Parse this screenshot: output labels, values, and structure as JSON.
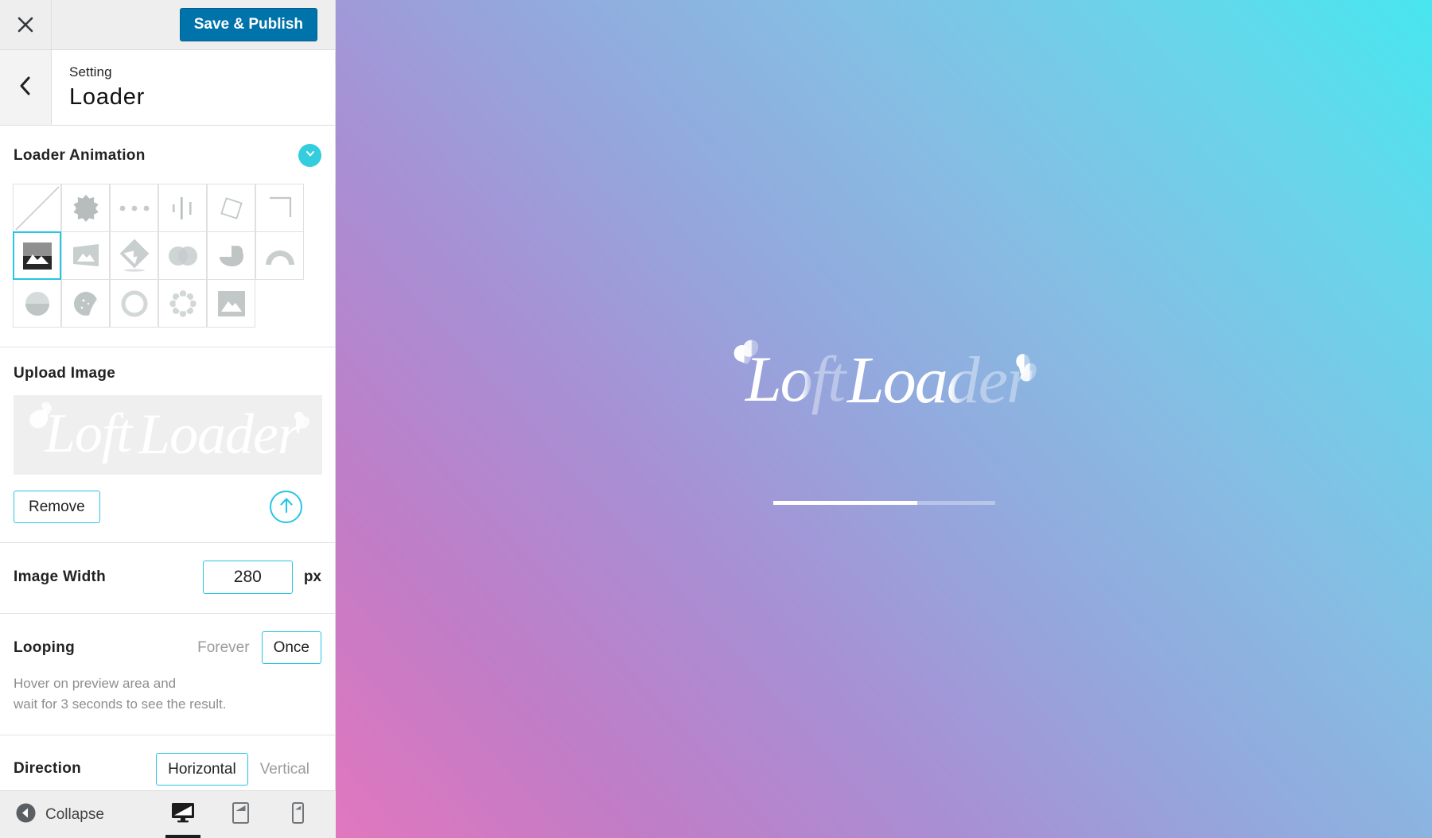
{
  "header": {
    "close_icon": "close-icon",
    "save_label": "Save & Publish",
    "save_color": "#0073aa"
  },
  "panel": {
    "back_icon": "chevron-left-icon",
    "breadcrumb": "Setting",
    "title": "Loader"
  },
  "accent_color": "#29c5e6",
  "toggle_color": "#33cddd",
  "sections": {
    "animation": {
      "label": "Loader Animation",
      "collapse_icon": "chevron-down-icon",
      "selected_index": 6,
      "items": [
        {
          "name": "none-diagonal-icon",
          "label": "None"
        },
        {
          "name": "starburst-icon",
          "label": "Starburst"
        },
        {
          "name": "three-dots-icon",
          "label": "Three Dots"
        },
        {
          "name": "equalizer-bars-icon",
          "label": "Bars"
        },
        {
          "name": "rotating-square-icon",
          "label": "Rotating Square"
        },
        {
          "name": "corner-bracket-icon",
          "label": "Corner Bracket"
        },
        {
          "name": "image-fill-icon",
          "label": "Image Fill"
        },
        {
          "name": "image-skew-icon",
          "label": "Image Skew"
        },
        {
          "name": "image-diamond-icon",
          "label": "Image Diamond"
        },
        {
          "name": "overlap-circles-icon",
          "label": "Overlapping Circles"
        },
        {
          "name": "blob-bird-icon",
          "label": "Blob"
        },
        {
          "name": "arch-icon",
          "label": "Arch"
        },
        {
          "name": "half-circle-icon",
          "label": "Half Circle"
        },
        {
          "name": "cookie-icon",
          "label": "Cookie"
        },
        {
          "name": "ring-icon",
          "label": "Ring"
        },
        {
          "name": "flower-ring-icon",
          "label": "Flower Ring"
        },
        {
          "name": "image-square-icon",
          "label": "Image Square"
        }
      ]
    },
    "upload": {
      "label": "Upload Image",
      "preview_alt": "LoftLoader",
      "remove_label": "Remove",
      "upload_icon": "upload-arrow-icon"
    },
    "image_width": {
      "label": "Image Width",
      "value": "280",
      "unit": "px"
    },
    "looping": {
      "label": "Looping",
      "options": [
        "Forever",
        "Once"
      ],
      "selected": "Once",
      "help_line_1": "Hover on preview area and",
      "help_line_2": "wait for 3 seconds to see the result."
    },
    "direction": {
      "label": "Direction",
      "options": [
        "Horizontal",
        "Vertical"
      ],
      "selected": "Horizontal"
    }
  },
  "bottom_bar": {
    "collapse_icon": "collapse-left-icon",
    "collapse_label": "Collapse",
    "devices": [
      {
        "name": "desktop-icon",
        "label": "Desktop",
        "active": true
      },
      {
        "name": "tablet-icon",
        "label": "Tablet",
        "active": false
      },
      {
        "name": "mobile-icon",
        "label": "Mobile",
        "active": false
      }
    ]
  },
  "preview": {
    "logo_text": "LoftLoader",
    "gradient_from": "#e177bf",
    "gradient_to": "#47e6ef",
    "progress_percent": "65"
  }
}
